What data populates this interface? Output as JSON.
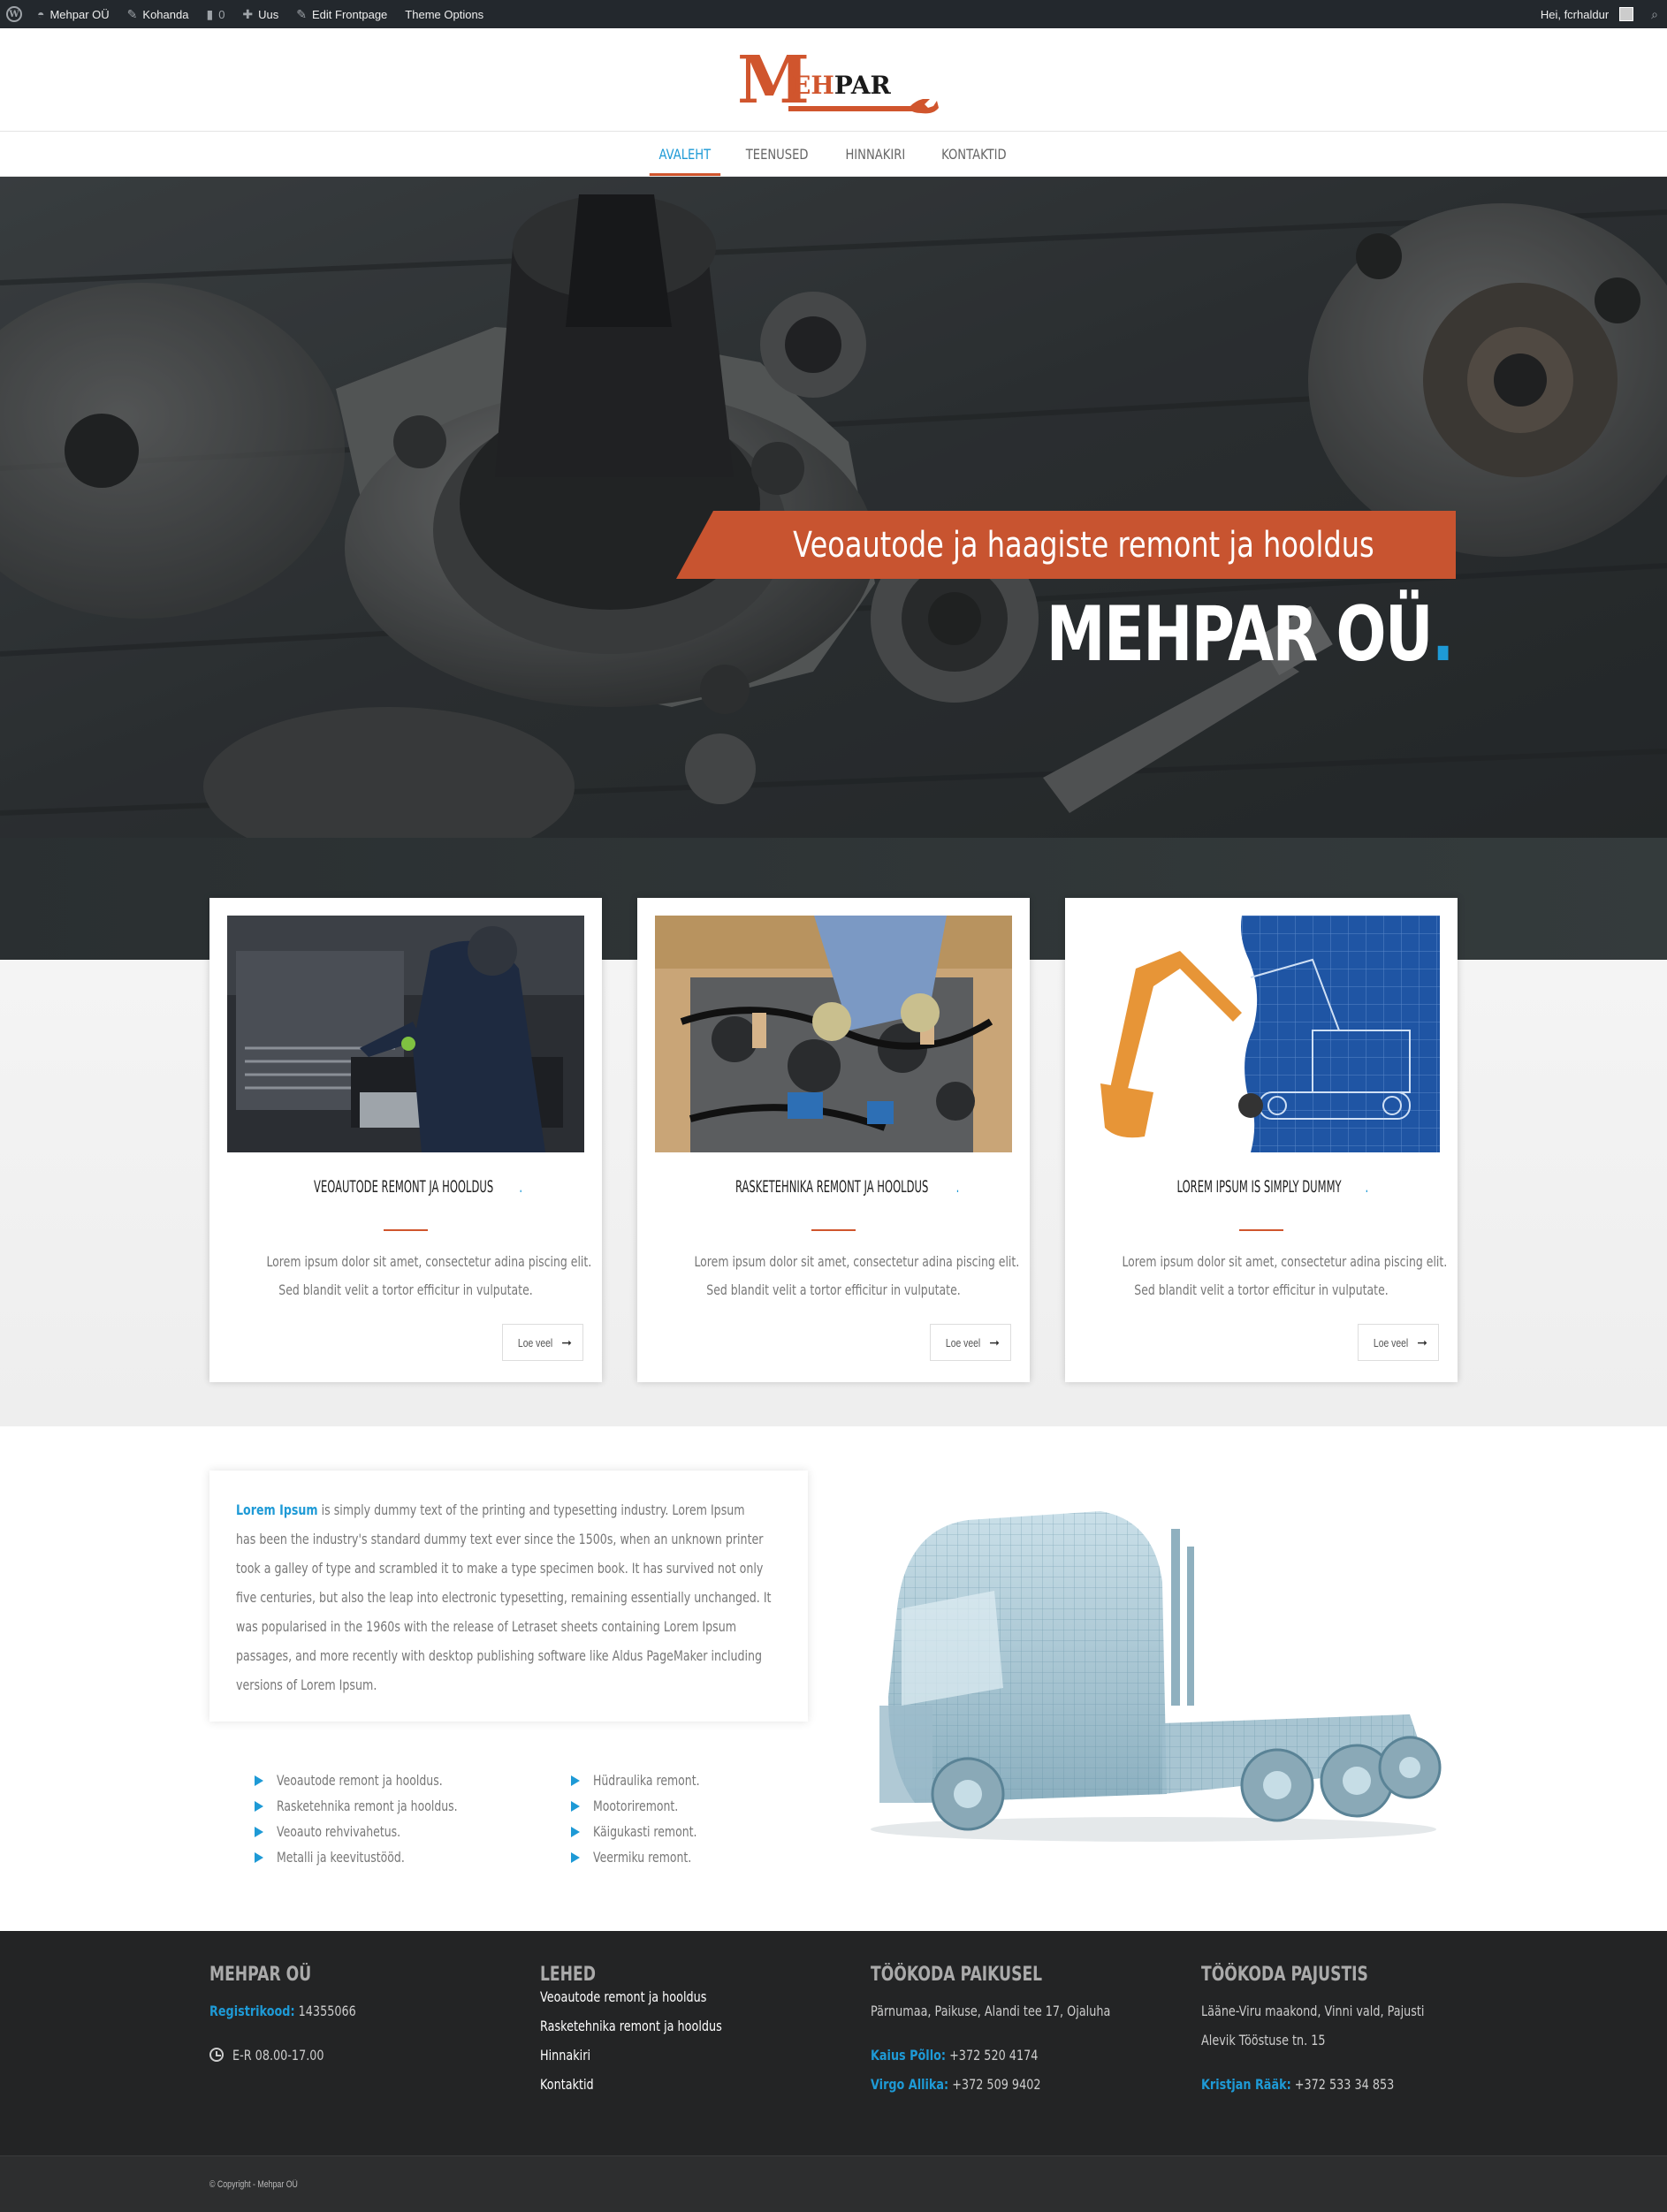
{
  "adminbar": {
    "site": "Mehpar OÜ",
    "customize": "Kohanda",
    "comments": "0",
    "new": "Uus",
    "edit": "Edit Frontpage",
    "theme": "Theme Options",
    "greeting": "Hei, fcrhaldur"
  },
  "logo": {
    "m": "M",
    "ehpar": "EHPAR"
  },
  "nav": [
    "AVALEHT",
    "TEENUSED",
    "HINNAKIRI",
    "KONTAKTID"
  ],
  "hero": {
    "title": "MEHPAR OÜ",
    "dot": ".",
    "subtitle": "Veoautode ja haagiste remont ja hooldus"
  },
  "cards": [
    {
      "title": "VEOAUTODE REMONT JA HOOLDUS",
      "dot": ".",
      "line1": "Lorem ipsum dolor sit amet, consectetur adina piscing elit.",
      "line2": "Sed blandit velit a tortor efficitur in vulputate.",
      "button": "Loe veel"
    },
    {
      "title": "RASKETEHNIKA REMONT JA HOOLDUS",
      "dot": ".",
      "line1": "Lorem ipsum dolor sit amet, consectetur adina piscing elit.",
      "line2": "Sed blandit velit a tortor efficitur in vulputate.",
      "button": "Loe veel"
    },
    {
      "title": "LOREM IPSUM IS SIMPLY DUMMY",
      "dot": ".",
      "line1": "Lorem ipsum dolor sit amet, consectetur adina piscing elit.",
      "line2": "Sed blandit velit a tortor efficitur in vulputate.",
      "button": "Loe veel"
    }
  ],
  "about": {
    "highlight": "Lorem Ipsum",
    "line1": " is simply dummy text of the printing and typesetting industry. Lorem Ipsum",
    "line2": "has been the industry's standard dummy text ever since the 1500s, when an unknown printer",
    "line3": "took a galley of type and scrambled it to make a type specimen book. It has survived not only",
    "line4": "five centuries, but also the leap into electronic typesetting, remaining essentially unchanged. It",
    "line5": "was popularised in the 1960s with the release of Letraset sheets containing Lorem Ipsum",
    "line6": "passages, and more recently with desktop publishing software like Aldus PageMaker including",
    "line7": "versions of Lorem Ipsum."
  },
  "services_left": [
    "Veoautode remont ja hooldus.",
    "Rasketehnika remont ja hooldus.",
    "Veoauto rehvivahetus.",
    "Metalli ja keevitustööd."
  ],
  "services_right": [
    "Hüdraulika remont.",
    "Mootoriremont.",
    "Käigukasti remont.",
    "Veermiku remont."
  ],
  "footer": {
    "col1": {
      "title": "MEHPAR OÜ",
      "reg_label": "Registrikood:",
      "reg_value": " 14355066",
      "hours": "E-R 08.00-17.00"
    },
    "col2": {
      "title": "LEHED",
      "links": [
        "Veoautode remont ja hooldus",
        "Rasketehnika remont ja hooldus",
        "Hinnakiri",
        "Kontaktid"
      ]
    },
    "col3": {
      "title": "TÖÖKODA PAIKUSEL",
      "address": "Pärnumaa, Paikuse, Alandi tee 17, Ojaluha",
      "c1_name": "Kaius Põllo:",
      "c1_phone": " +372 520 4174",
      "c2_name": "Virgo Allika:",
      "c2_phone": " +372 509 9402"
    },
    "col4": {
      "title": "TÖÖKODA PAJUSTIS",
      "address1": "Lääne-Viru maakond, Vinni vald, Pajusti",
      "address2": "Alevik Tööstuse tn. 15",
      "c1_name": "Kristjan Rääk:",
      "c1_phone": " +372 533 34 853"
    },
    "copyright": "© Copyright - Mehpar OÜ"
  },
  "colors": {
    "accent": "#1e9ad6",
    "brand": "#d0552d",
    "dark": "#232425"
  }
}
